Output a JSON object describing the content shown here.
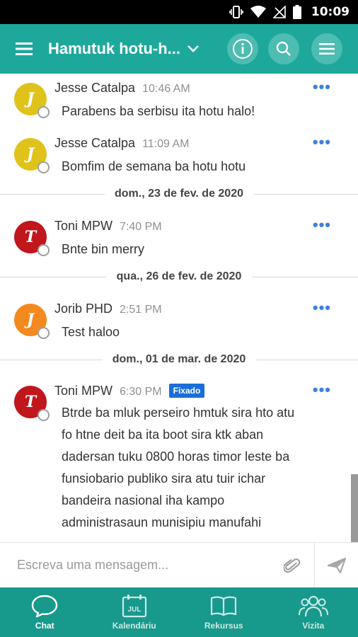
{
  "status_bar": {
    "time": "10:09",
    "icons": [
      "vibrate-icon",
      "wifi-icon",
      "no-signal-icon",
      "battery-icon"
    ]
  },
  "header": {
    "title": "Hamutuk hotu-h...",
    "buttons": [
      "info-icon",
      "search-icon",
      "menu-icon"
    ]
  },
  "colors": {
    "header_bg": "#1ea89b",
    "nav_bg": "#17998c",
    "pinned_badge": "#1a6fd6",
    "avatar_yellow": "#e0c31a",
    "avatar_red": "#c0161c",
    "avatar_orange": "#f48a1f"
  },
  "messages": [
    {
      "initial": "J",
      "author": "Jesse Catalpa",
      "time": "10:46 AM",
      "text": "Parabens ba serbisu ita hotu halo!",
      "avatar_color": "#e0c31a"
    },
    {
      "initial": "J",
      "author": "Jesse Catalpa",
      "time": "11:09 AM",
      "text": "Bomfim de semana ba hotu hotu",
      "avatar_color": "#e0c31a"
    },
    {
      "date_separator": "dom., 23 de fev. de 2020"
    },
    {
      "initial": "T",
      "author": "Toni MPW",
      "time": "7:40 PM",
      "text": "Bnte bin merry",
      "avatar_color": "#c0161c"
    },
    {
      "date_separator": "qua., 26 de fev. de 2020"
    },
    {
      "initial": "J",
      "author": "Jorib PHD",
      "time": "2:51 PM",
      "text": "Test haloo",
      "avatar_color": "#f48a1f"
    },
    {
      "date_separator": "dom., 01 de mar. de 2020"
    },
    {
      "initial": "T",
      "author": "Toni MPW",
      "time": "6:30 PM",
      "badge": "Fixado",
      "text_lines": [
        "Btrde ba mluk perseiro hmtuk sira hto atu",
        "fo htne deit ba ita boot sira ktk aban",
        "dadersan tuku 0800 horas timor leste ba",
        "funsiobario publiko sira atu tuir ichar",
        "bandeira nasional iha kampo",
        "administrasaun munisipiu manufahi"
      ],
      "avatar_color": "#c0161c"
    }
  ],
  "more_label": "•••",
  "composer": {
    "placeholder": "Escreva uma mensagem...",
    "value": ""
  },
  "bottom_nav": {
    "items": [
      {
        "label": "Chat",
        "icon": "chat-bubble-icon",
        "active": true
      },
      {
        "label": "Kalendáriu",
        "icon": "calendar-icon",
        "calendar_text": "JUL",
        "active": false
      },
      {
        "label": "Rekursus",
        "icon": "book-icon",
        "active": false
      },
      {
        "label": "Vizita",
        "icon": "people-icon",
        "active": false
      }
    ]
  }
}
